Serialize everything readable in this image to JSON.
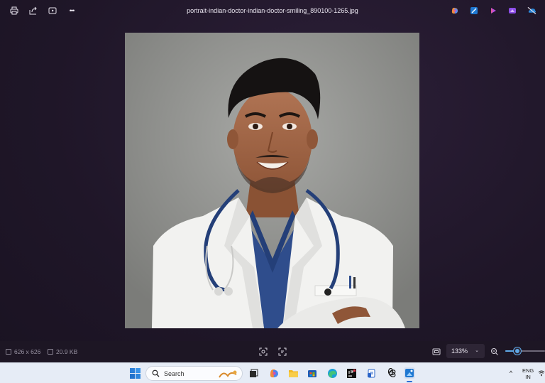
{
  "window": {
    "filename": "portrait-indian-doctor-indian-doctor-smiling_890100-1265.jpg"
  },
  "toolbar": {
    "left_icons": [
      "print-icon",
      "share-icon",
      "slideshow-icon",
      "more-icon"
    ],
    "more_label": "•••",
    "right_apps": [
      "copilot-icon",
      "photos-edit-icon",
      "clipchamp-icon",
      "designer-icon",
      "onedrive-icon"
    ]
  },
  "status": {
    "dimensions": "626 x 626",
    "filesize": "20.9 KB",
    "zoom": "133%",
    "zoom_chevron": "⌄",
    "zoom_level_fraction": 0.3
  },
  "taskbar": {
    "search_placeholder": "Search",
    "apps": [
      "start-icon",
      "taskview-icon",
      "copilot-icon",
      "file-explorer-icon",
      "store-icon",
      "edge-icon",
      "jetbrains-icon",
      "app-icon",
      "chatgpt-icon",
      "photos-icon"
    ],
    "tray_chevron": "^",
    "lang_top": "ENG",
    "lang_bottom": "IN"
  },
  "colors": {
    "accent": "#5fa9e8",
    "coat": "#f2f2f0",
    "scrubs": "#2f4d8c"
  }
}
